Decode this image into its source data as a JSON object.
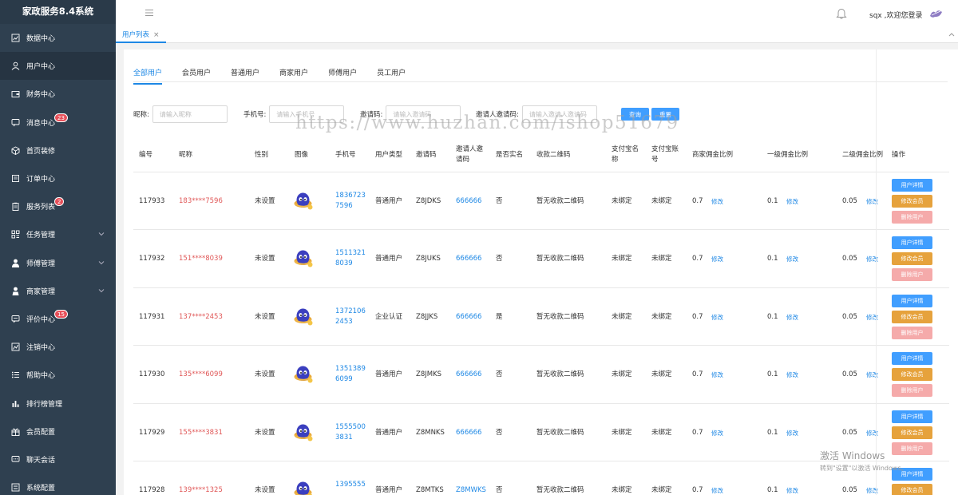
{
  "app": {
    "title": "家政服务8.4系统"
  },
  "sidebar": {
    "items": [
      {
        "label": "数据中心",
        "icon": "chart-icon"
      },
      {
        "label": "用户中心",
        "icon": "user-icon",
        "active": true
      },
      {
        "label": "财务中心",
        "icon": "wallet-icon"
      },
      {
        "label": "消息中心",
        "icon": "message-icon",
        "badge": "23"
      },
      {
        "label": "首页装修",
        "icon": "cube-icon"
      },
      {
        "label": "订单中心",
        "icon": "cart-icon"
      },
      {
        "label": "服务列表",
        "icon": "clipboard-icon",
        "badge": "2"
      },
      {
        "label": "任务管理",
        "icon": "grid-icon",
        "chevron": true
      },
      {
        "label": "师傅管理",
        "icon": "person-icon",
        "chevron": true
      },
      {
        "label": "商家管理",
        "icon": "shop-icon",
        "chevron": true
      },
      {
        "label": "评价中心",
        "icon": "comment-icon",
        "badge": "15"
      },
      {
        "label": "注销中心",
        "icon": "logout-chart-icon"
      },
      {
        "label": "帮助中心",
        "icon": "list-icon"
      },
      {
        "label": "排行榜管理",
        "icon": "bar-chart-icon"
      },
      {
        "label": "会员配置",
        "icon": "gift-icon"
      },
      {
        "label": "聊天会话",
        "icon": "chat-icon"
      },
      {
        "label": "系统配置",
        "icon": "settings-icon"
      }
    ]
  },
  "header": {
    "welcome": "sqx ,欢迎您登录"
  },
  "tabbar": {
    "tab_label": "用户列表",
    "close": "×"
  },
  "subtabs": [
    "全部用户",
    "会员用户",
    "普通用户",
    "商家用户",
    "师傅用户",
    "员工用户"
  ],
  "filters": {
    "nickname_label": "昵称:",
    "nickname_placeholder": "请输入昵称",
    "phone_label": "手机号:",
    "phone_placeholder": "请输入手机号",
    "invite_label": "邀请码:",
    "invite_placeholder": "请输入邀请码",
    "inviter_label": "邀请人邀请码:",
    "inviter_placeholder": "请输入邀请人邀请码",
    "query_button": "查询",
    "reset_button": "重置"
  },
  "table": {
    "headers": {
      "id": "编号",
      "nickname": "昵称",
      "gender": "性别",
      "avatar": "图像",
      "phone": "手机号",
      "user_type": "用户类型",
      "invite_code": "邀请码",
      "inviter_line1": "邀请人邀",
      "inviter_line2": "请码",
      "realname": "是否实名",
      "qrcode": "收款二维码",
      "alipay_name_line1": "支付宝名",
      "alipay_name_line2": "称",
      "alipay_account_line1": "支付宝账",
      "alipay_account_line2": "号",
      "merchant_ratio": "商家佣金比例",
      "level1_ratio": "一级佣金比例",
      "level2_ratio": "二级佣金比例",
      "ops": "操作"
    },
    "modify_label": "修改",
    "op_labels": {
      "detail": "用户详情",
      "modify_member": "修改会员",
      "delete": "删除用户"
    },
    "rows": [
      {
        "id": "117933",
        "nickname": "183****7596",
        "gender": "未设置",
        "phone1": "1836723",
        "phone2": "7596",
        "user_type": "普通用户",
        "invite_code": "Z8JDKS",
        "inviter": "666666",
        "realname": "否",
        "qrcode": "暂无收款二维码",
        "alipay_name": "未绑定",
        "alipay_account": "未绑定",
        "merchant_ratio": "0.7",
        "level1_ratio": "0.1",
        "level2_ratio": "0.05"
      },
      {
        "id": "117932",
        "nickname": "151****8039",
        "gender": "未设置",
        "phone1": "1511321",
        "phone2": "8039",
        "user_type": "普通用户",
        "invite_code": "Z8JUKS",
        "inviter": "666666",
        "realname": "否",
        "qrcode": "暂无收款二维码",
        "alipay_name": "未绑定",
        "alipay_account": "未绑定",
        "merchant_ratio": "0.7",
        "level1_ratio": "0.1",
        "level2_ratio": "0.05"
      },
      {
        "id": "117931",
        "nickname": "137****2453",
        "gender": "未设置",
        "phone1": "1372106",
        "phone2": "2453",
        "user_type": "企业认证",
        "invite_code": "Z8JJKS",
        "inviter": "666666",
        "realname": "是",
        "qrcode": "暂无收款二维码",
        "alipay_name": "未绑定",
        "alipay_account": "未绑定",
        "merchant_ratio": "0.7",
        "level1_ratio": "0.1",
        "level2_ratio": "0.05"
      },
      {
        "id": "117930",
        "nickname": "135****6099",
        "gender": "未设置",
        "phone1": "1351389",
        "phone2": "6099",
        "user_type": "普通用户",
        "invite_code": "Z8JMKS",
        "inviter": "666666",
        "realname": "否",
        "qrcode": "暂无收款二维码",
        "alipay_name": "未绑定",
        "alipay_account": "未绑定",
        "merchant_ratio": "0.7",
        "level1_ratio": "0.1",
        "level2_ratio": "0.05"
      },
      {
        "id": "117929",
        "nickname": "155****3831",
        "gender": "未设置",
        "phone1": "1555500",
        "phone2": "3831",
        "user_type": "普通用户",
        "invite_code": "Z8MNKS",
        "inviter": "666666",
        "realname": "否",
        "qrcode": "暂无收款二维码",
        "alipay_name": "未绑定",
        "alipay_account": "未绑定",
        "merchant_ratio": "0.7",
        "level1_ratio": "0.1",
        "level2_ratio": "0.05"
      },
      {
        "id": "117928",
        "nickname": "139****1325",
        "gender": "未设置",
        "phone1": "1395555",
        "phone2": "",
        "user_type": "普通用户",
        "invite_code": "Z8MTKS",
        "inviter": "Z8MWKS",
        "realname": "否",
        "qrcode": "暂无收款二维码",
        "alipay_name": "未绑定",
        "alipay_account": "未绑定",
        "merchant_ratio": "0.7",
        "level1_ratio": "0.1",
        "level2_ratio": "0.05"
      }
    ]
  },
  "overlay": {
    "watermark": "https://www.huzhan.com/ishop51679",
    "activate_line1": "激活 Windows",
    "activate_line2": "转到\"设置\"以激活 Windows。"
  },
  "colors": {
    "sidebar_bg": "#2f4050",
    "primary": "#1e88e5",
    "danger_text": "#e05858",
    "warning": "#e6a23c",
    "delete_btn": "#f5aaaa"
  }
}
